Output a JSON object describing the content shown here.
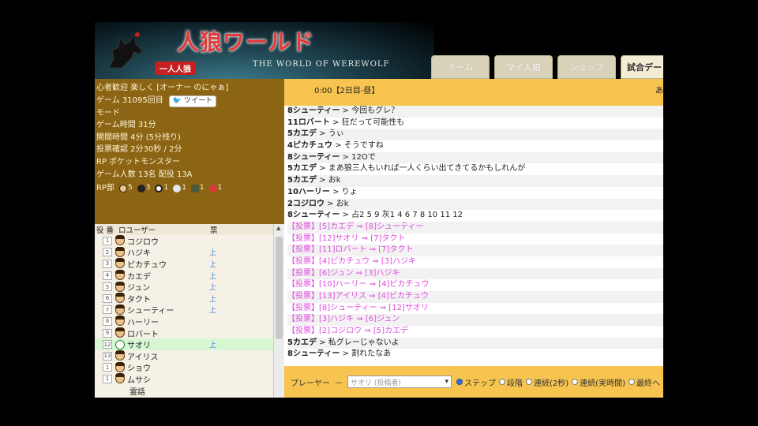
{
  "header": {
    "logo_title": "人狼ワールド",
    "logo_subtitle": "THE WORLD OF WEREWOLF",
    "logo_badge": "一人人狼",
    "tabs": [
      "ホーム",
      "マイ人狼",
      "ショップ",
      "試合デー"
    ]
  },
  "info": {
    "line1": "心者歓迎 楽しく [オーナー のにゃぁ]",
    "line2": "ゲーム 31095回目",
    "tweet_label": "ツイート",
    "line3": "モード",
    "line4": "ゲーム時間 31分",
    "line5": "開間時間 4分 (5分残り)",
    "line6": "投票確認 2分30秒 / 2分",
    "line7": "RP ポケットモンスター",
    "line8": "ゲーム人数 13名 配役 13A",
    "rp_label": "RP部",
    "rp_counts": [
      "5",
      "3",
      "1",
      "1",
      "1",
      "1"
    ]
  },
  "players": {
    "headers": [
      "役 番",
      "ロユーザー",
      "票"
    ],
    "rows": [
      {
        "num": "1",
        "name": "コジロウ",
        "vote": ""
      },
      {
        "num": "2",
        "name": "ハジキ",
        "vote": "上"
      },
      {
        "num": "3",
        "name": "ピカチュウ",
        "vote": "上"
      },
      {
        "num": "4",
        "name": "カエデ",
        "vote": "上"
      },
      {
        "num": "5",
        "name": "ジュン",
        "vote": "上"
      },
      {
        "num": "6",
        "name": "タクト",
        "vote": "上"
      },
      {
        "num": "7",
        "name": "シューティー",
        "vote": "上"
      },
      {
        "num": "8",
        "name": "ハーリー",
        "vote": ""
      },
      {
        "num": "9",
        "name": "ロバート",
        "vote": ""
      },
      {
        "num": "12",
        "name": "サオリ",
        "vote": "上"
      },
      {
        "num": "13",
        "name": "アイリス",
        "vote": ""
      },
      {
        "num": "1",
        "name": "ショウ",
        "vote": ""
      },
      {
        "num": "1",
        "name": "ムサシ",
        "vote": ""
      }
    ],
    "footer": "霊話"
  },
  "chat": {
    "time_header": "0:00【2日目-昼】",
    "right_note": "あ",
    "messages": [
      {
        "type": "say",
        "speaker": "8シューティー",
        "text": " > 今回もグレ？"
      },
      {
        "type": "say",
        "speaker": "11ロバート",
        "text": " > 狂だって可能性も"
      },
      {
        "type": "say",
        "speaker": "5カエデ",
        "text": " > うぃ"
      },
      {
        "type": "say",
        "speaker": "4ピカチュウ",
        "text": " > そうですね"
      },
      {
        "type": "say",
        "speaker": "8シューティー",
        "text": " > 12Oで"
      },
      {
        "type": "say",
        "speaker": "5カエデ",
        "text": " > まあ狼三人もいれば一人くらい出てきてるかもしれんが"
      },
      {
        "type": "say",
        "speaker": "5カエデ",
        "text": " > おk"
      },
      {
        "type": "say",
        "speaker": "10ハーリー",
        "text": " > りょ"
      },
      {
        "type": "say",
        "speaker": "2コジロウ",
        "text": " > おk"
      },
      {
        "type": "say",
        "speaker": "8シューティー",
        "text": " > 占2 5 9 灰1 4 6 7 8 10 11 12"
      },
      {
        "type": "vote",
        "speaker": "",
        "text": "【投票】[5]カエデ ⇒ [8]シューティー"
      },
      {
        "type": "vote",
        "speaker": "",
        "text": "【投票】[12]サオリ ⇒ [7]タクト"
      },
      {
        "type": "vote",
        "speaker": "",
        "text": "【投票】[11]ロバート ⇒ [7]タクト"
      },
      {
        "type": "vote",
        "speaker": "",
        "text": "【投票】[4]ピカチュウ ⇒ [3]ハジキ"
      },
      {
        "type": "vote",
        "speaker": "",
        "text": "【投票】[6]ジュン ⇒ [3]ハジキ"
      },
      {
        "type": "vote",
        "speaker": "",
        "text": "【投票】[10]ハーリー ⇒ [4]ピカチュウ"
      },
      {
        "type": "vote",
        "speaker": "",
        "text": "【投票】[13]アイリス ⇒ [4]ピカチュウ"
      },
      {
        "type": "vote",
        "speaker": "",
        "text": "【投票】[8]シューティー ⇒ [12]サオリ"
      },
      {
        "type": "vote",
        "speaker": "",
        "text": "【投票】[3]ハジキ ⇒ [6]ジュン"
      },
      {
        "type": "vote",
        "speaker": "",
        "text": "【投票】[2]コジロウ ⇒ [5]カエデ"
      },
      {
        "type": "say",
        "speaker": "5カエデ",
        "text": " > 私グレーじゃないよ"
      },
      {
        "type": "say",
        "speaker": "8シューティー",
        "text": " > 割れたなあ"
      }
    ]
  },
  "controls": {
    "player_label": "プレーヤー",
    "select_value": "サオリ (投稿者)",
    "options": [
      "ステップ",
      "段階",
      "連続(2秒)",
      "連続(実時間)",
      "最終へ"
    ],
    "selected": 0
  }
}
